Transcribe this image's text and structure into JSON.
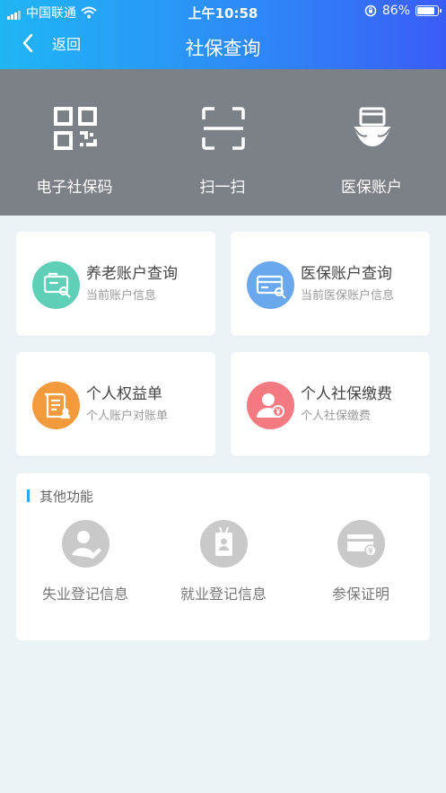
{
  "status_bar": {
    "carrier": "中国联通",
    "time": "上午10:58",
    "battery": "86%",
    "battery_level": 0.86
  },
  "nav": {
    "back_label": "返回",
    "title": "社保查询"
  },
  "quick_actions": [
    {
      "label": "电子社保码",
      "icon": "qr-code-icon"
    },
    {
      "label": "扫一扫",
      "icon": "scan-icon"
    },
    {
      "label": "医保账户",
      "icon": "card-hands-icon"
    }
  ],
  "cards": [
    {
      "title": "养老账户查询",
      "subtitle": "当前账户信息",
      "icon": "pension-account-icon",
      "color": "#5fcfb8"
    },
    {
      "title": "医保账户查询",
      "subtitle": "当前医保账户信息",
      "icon": "medical-card-icon",
      "color": "#6aa8ee"
    },
    {
      "title": "个人权益单",
      "subtitle": "个人账户对账单",
      "icon": "statement-icon",
      "color": "#f39a3c"
    },
    {
      "title": "个人社保缴费",
      "subtitle": "个人社保缴费",
      "icon": "payment-user-icon",
      "color": "#f27a80"
    }
  ],
  "other_functions": {
    "heading": "其他功能",
    "items": [
      {
        "label": "失业登记信息",
        "icon": "user-edit-icon"
      },
      {
        "label": "就业登记信息",
        "icon": "id-badge-icon"
      },
      {
        "label": "参保证明",
        "icon": "card-yen-icon"
      }
    ]
  },
  "colors": {
    "header_start": "#1fb6f5",
    "header_end": "#3a5cf6",
    "quickbar_bg": "#7c8087",
    "page_bg": "#ecf3f6",
    "accent": "#2aa6f5"
  }
}
